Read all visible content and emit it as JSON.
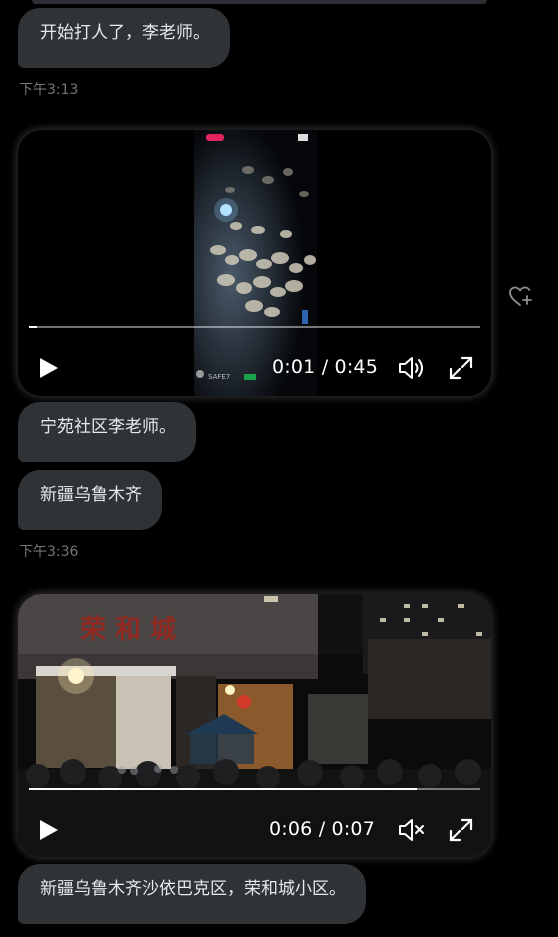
{
  "messages": [
    {
      "text": "开始打人了，李老师。"
    },
    {
      "text": "宁苑社区李老师。"
    },
    {
      "text": "新疆乌鲁木齐"
    },
    {
      "text": "新疆乌鲁木齐沙依巴克区，荣和城小区。"
    }
  ],
  "timestamps": [
    "下午3:13",
    "下午3:36"
  ],
  "videos": [
    {
      "time": "0:01 / 0:45",
      "progress": 0.017,
      "muted": false,
      "overlay_text": "SAFE7"
    },
    {
      "time": "0:06 / 0:07",
      "progress": 0.86,
      "muted": true,
      "sign_text": "荣 和 城"
    }
  ],
  "icons": {
    "play": "play-icon",
    "volume": "volume-icon",
    "muted": "volume-muted-icon",
    "fullscreen": "fullscreen-icon",
    "react": "heart-plus-icon"
  }
}
